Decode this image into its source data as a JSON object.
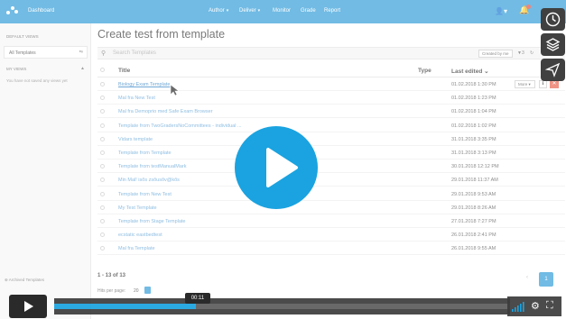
{
  "nav": {
    "brand": "Dashboard",
    "items": [
      {
        "label": "Author",
        "dropdown": true
      },
      {
        "label": "Deliver",
        "dropdown": true
      },
      {
        "label": "Monitor",
        "dropdown": false
      },
      {
        "label": "Grade",
        "dropdown": false
      },
      {
        "label": "Report",
        "dropdown": false
      }
    ],
    "user_icon": "user-icon",
    "bell_icon": "bell-icon",
    "color": "#2f9bd8"
  },
  "sidebar": {
    "default_views_heading": "DEFAULT VIEWS",
    "all_templates": "All Templates",
    "my_views_heading": "MY VIEWS",
    "empty_text": "You have not saved any views yet",
    "archived": "Archived Templates"
  },
  "main": {
    "title": "Create test from template",
    "search_placeholder": "Search Templates",
    "created_by": "Created by me",
    "filter_count": "3",
    "columns": {
      "title": "Title",
      "type": "Type",
      "edited": "Last edited"
    },
    "rows": [
      {
        "title": "Biology Exam Template",
        "date": "01.02.2018 1:30 PM"
      },
      {
        "title": "Mal fra New Test",
        "date": "01.02.2018 1:23 PM"
      },
      {
        "title": "Mal fra Demoprio med Safe Exam Browser",
        "date": "01.02.2018 1:04 PM"
      },
      {
        "title": "Template from TwoGradersNoCommittees - individual ...",
        "date": "01.02.2018 1:02 PM"
      },
      {
        "title": "Vidars template",
        "date": "31.01.2018 3:35 PM"
      },
      {
        "title": "Template from Template",
        "date": "31.01.2018 3:13 PM"
      },
      {
        "title": "Template from testManualMark",
        "date": "30.01.2018 12:12 PM"
      },
      {
        "title": "Min Mal! isõs zsõusõv@kõs",
        "date": "29.01.2018 11:37 AM"
      },
      {
        "title": "Template from New Test",
        "date": "29.01.2018 9:53 AM"
      },
      {
        "title": "My Test Template",
        "date": "29.01.2018 8:26 AM"
      },
      {
        "title": "Template from Stage Template",
        "date": "27.01.2018 7:27 PM"
      },
      {
        "title": "ecstatic eastbedtest",
        "date": "26.01.2018 2:41 PM"
      },
      {
        "title": "Mal fra Template",
        "date": "26.01.2018 9:55 AM"
      }
    ],
    "more_label": "More",
    "count_text": "1 - 13 of 13",
    "hits_per_page_label": "Hits per page:",
    "hits_per_page_value": "20",
    "current_page": "1"
  },
  "player": {
    "time": "00:11",
    "progress": 0.31,
    "accent": "#1aa3e0",
    "side_buttons": [
      "clock-icon",
      "layers-icon",
      "send-icon"
    ]
  }
}
